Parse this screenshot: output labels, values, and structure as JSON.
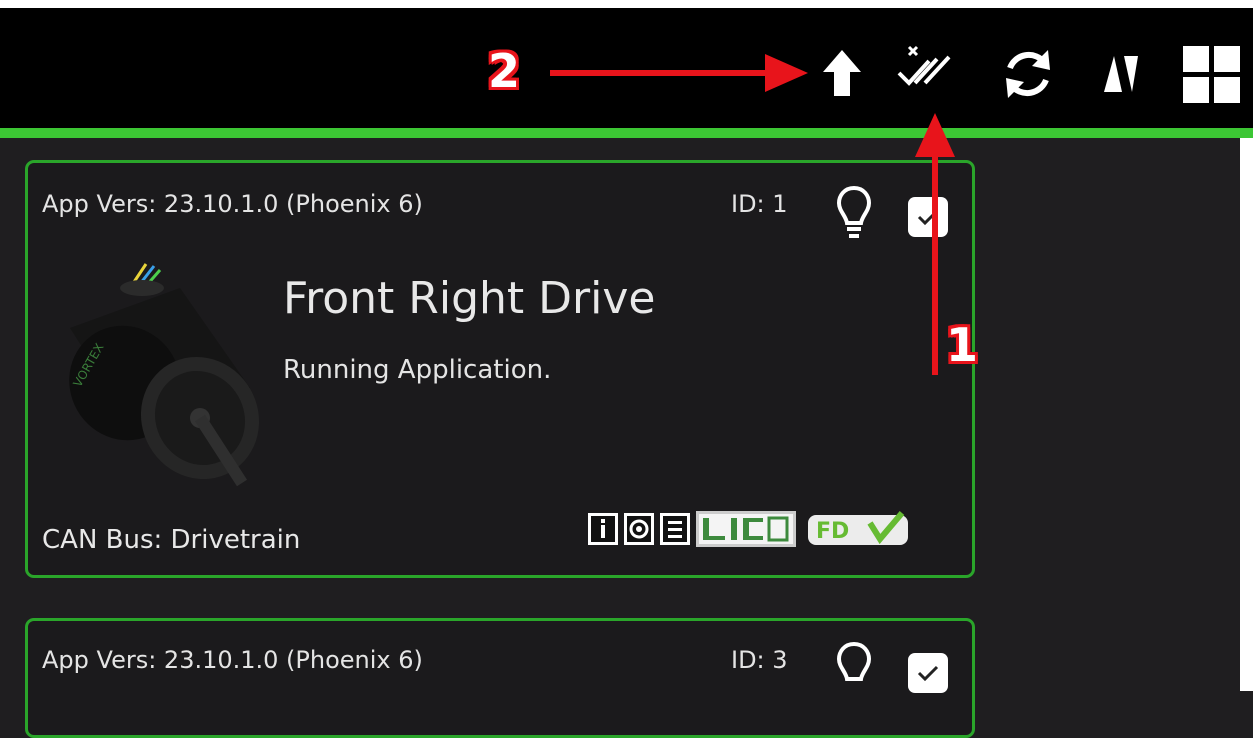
{
  "toolbar": {
    "icons": [
      "upload-arrow-icon",
      "deselect-all-icon",
      "refresh-icon",
      "sort-icon",
      "grid-view-icon"
    ]
  },
  "devices": [
    {
      "app_version": "App Vers: 23.10.1.0 (Phoenix 6)",
      "id_label": "ID: 1",
      "name": "Front Right Drive",
      "status": "Running Application.",
      "can_bus": "CAN Bus: Drivetrain",
      "checked": true,
      "badges": [
        "info-icon",
        "config-icon",
        "clipboard-icon",
        "lic-badge",
        "fdv-badge"
      ]
    },
    {
      "app_version": "App Vers: 23.10.1.0 (Phoenix 6)",
      "id_label": "ID: 3",
      "checked": true
    }
  ],
  "annotations": {
    "label_1": "1",
    "label_2": "2"
  },
  "colors": {
    "accent_green": "#3cc634",
    "card_border": "#2aa52a",
    "annotation_red": "#e8141b"
  }
}
